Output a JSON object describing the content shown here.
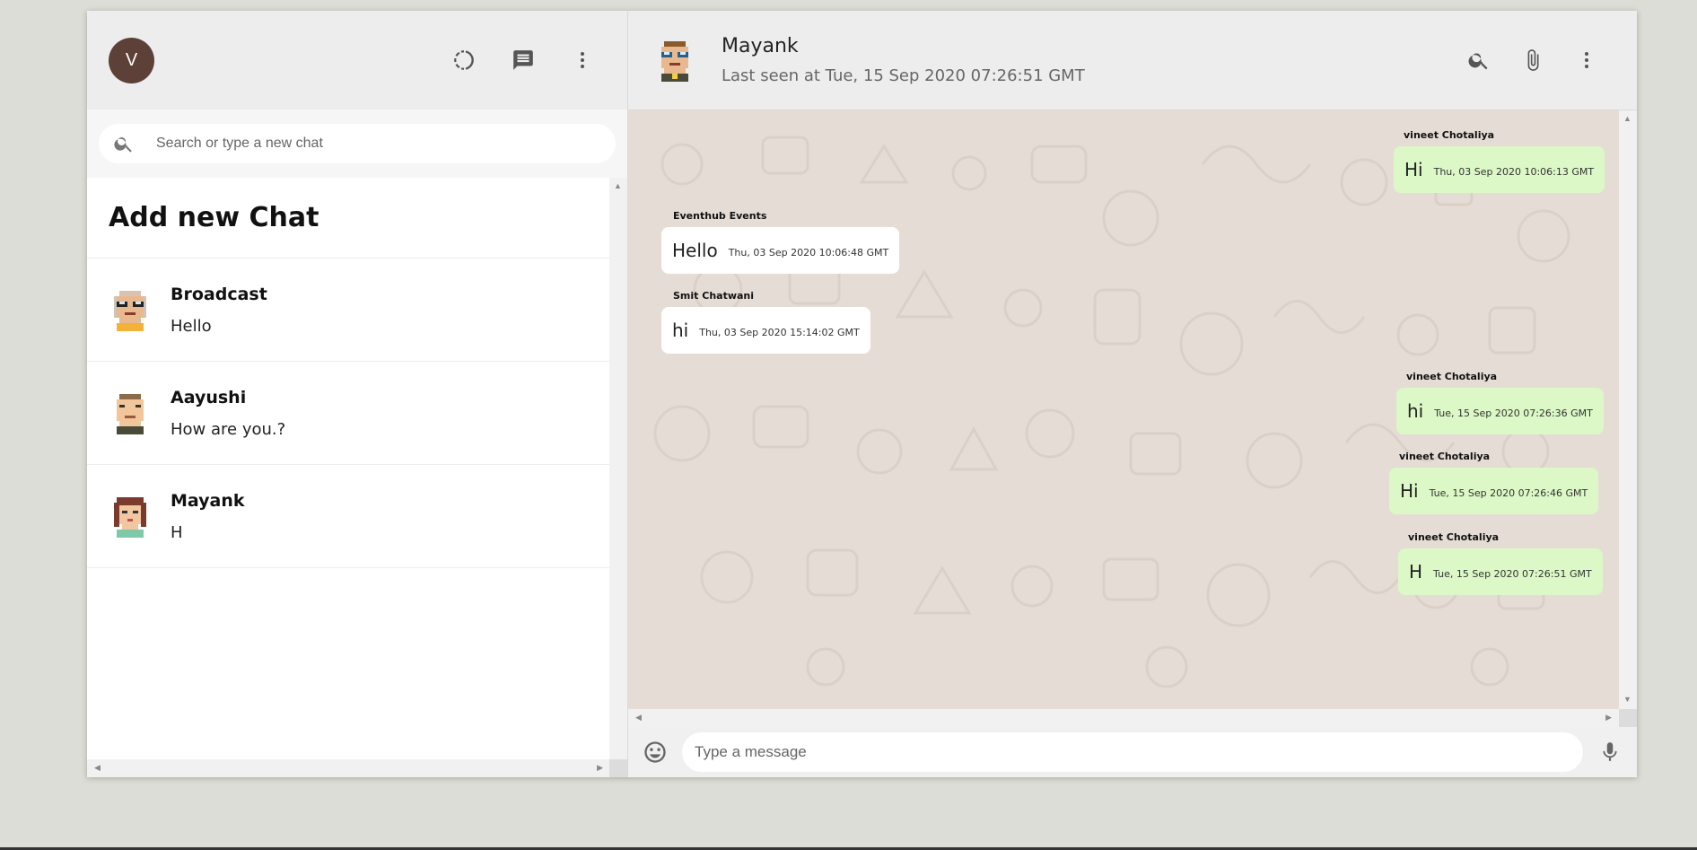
{
  "sidebar": {
    "avatar_initial": "V",
    "search_placeholder": "Search or type a new chat",
    "add_chat_label": "Add new Chat",
    "chats": [
      {
        "name": "Broadcast",
        "last": "Hello"
      },
      {
        "name": "Aayushi",
        "last": "How are you.?"
      },
      {
        "name": "Mayank",
        "last": "H"
      }
    ]
  },
  "chat": {
    "name": "Mayank",
    "status": "Last seen at Tue, 15 Sep 2020 07:26:51 GMT",
    "messages": [
      {
        "sender": "vineet Chotaliya",
        "text": "Hi",
        "time": "Thu, 03 Sep 2020 10:06:13 GMT",
        "type": "sent"
      },
      {
        "sender": "Eventhub Events",
        "text": "Hello",
        "time": "Thu, 03 Sep 2020 10:06:48 GMT",
        "type": "received"
      },
      {
        "sender": "Smit Chatwani",
        "text": "hi",
        "time": "Thu, 03 Sep 2020 15:14:02 GMT",
        "type": "received"
      },
      {
        "sender": "vineet Chotaliya",
        "text": "hi",
        "time": "Tue, 15 Sep 2020 07:26:36 GMT",
        "type": "sent"
      },
      {
        "sender": "vineet Chotaliya",
        "text": "Hi",
        "time": "Tue, 15 Sep 2020 07:26:46 GMT",
        "type": "sent"
      },
      {
        "sender": "vineet Chotaliya",
        "text": "H",
        "time": "Tue, 15 Sep 2020 07:26:51 GMT",
        "type": "sent"
      }
    ],
    "input_placeholder": "Type a message"
  },
  "colors": {
    "sent_bubble": "#dcf8c6",
    "received_bubble": "#ffffff",
    "chat_background": "#e5ddd5",
    "avatar_bg": "#5d4037"
  },
  "icons": [
    "status-icon",
    "new-chat-icon",
    "menu-icon",
    "search-icon",
    "attach-icon",
    "emoji-icon",
    "mic-icon"
  ]
}
